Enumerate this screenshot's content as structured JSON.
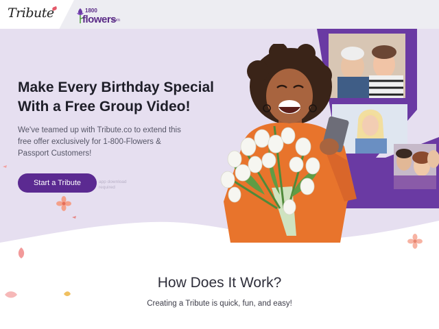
{
  "header": {
    "tribute_logo": "Tribute",
    "partner_logo": {
      "number": "1800",
      "word": "flowers",
      "suffix": ".com"
    }
  },
  "hero": {
    "headline_line1": "Make Every Birthday Special",
    "headline_line2": "With a Free Group Video!",
    "subcopy": "We've teamed up with Tribute.co to extend this free offer exclusively for 1-800-Flowers & Passport Customers!",
    "cta_label": "Start a Tribute",
    "faint_note": "app download required"
  },
  "how_it_works": {
    "title": "How Does It Work?",
    "subtitle": "Creating a Tribute is quick, fun, and easy!"
  },
  "colors": {
    "brand_purple": "#5b2a91",
    "hero_bg": "#e6dff0",
    "photo_frame": "#6a3aa3",
    "topbar_bg": "#ededf2"
  },
  "icons": [
    "tribute-logo",
    "flowers-logo",
    "petal-decoration",
    "flower-decoration"
  ]
}
